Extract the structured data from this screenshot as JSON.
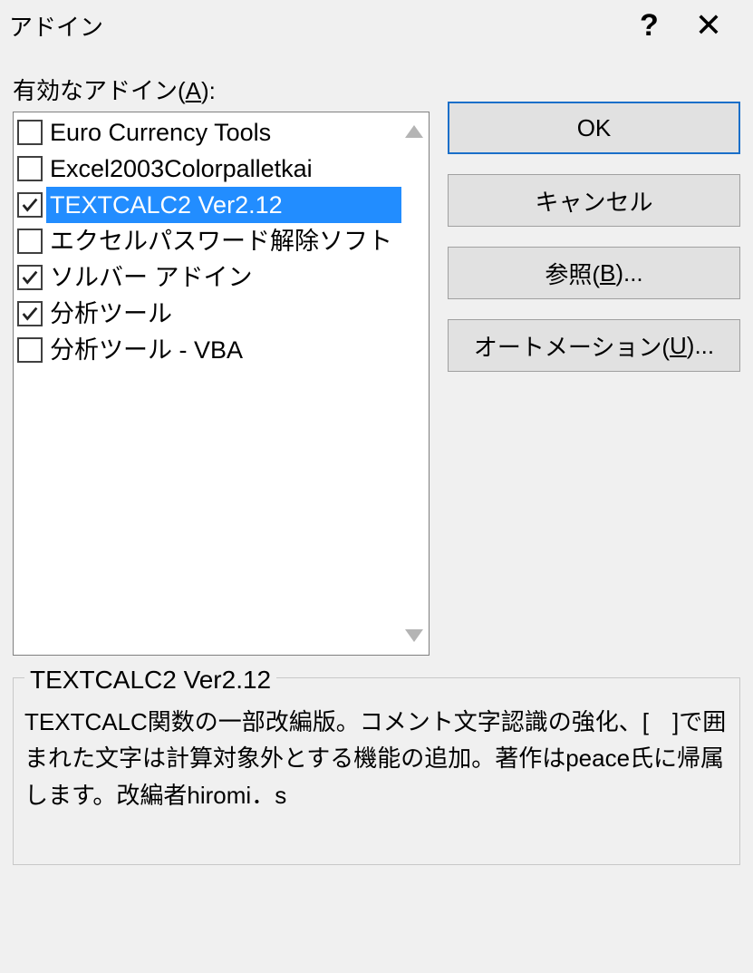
{
  "title": "アドイン",
  "label_available_prefix": "有効なアドイン(",
  "label_available_accel": "A",
  "label_available_suffix": "):",
  "items": [
    {
      "label": "Euro Currency Tools",
      "checked": false,
      "selected": false
    },
    {
      "label": "Excel2003Colorpalletkai",
      "checked": false,
      "selected": false
    },
    {
      "label": "TEXTCALC2  Ver2.12",
      "checked": true,
      "selected": true
    },
    {
      "label": "エクセルパスワード解除ソフト",
      "checked": false,
      "selected": false
    },
    {
      "label": "ソルバー アドイン",
      "checked": true,
      "selected": false
    },
    {
      "label": "分析ツール",
      "checked": true,
      "selected": false
    },
    {
      "label": "分析ツール - VBA",
      "checked": false,
      "selected": false
    }
  ],
  "buttons": {
    "ok": "OK",
    "cancel": "キャンセル",
    "browse_prefix": "参照(",
    "browse_accel": "B",
    "browse_suffix": ")...",
    "automation_prefix": "オートメーション(",
    "automation_accel": "U",
    "automation_suffix": ")..."
  },
  "description": {
    "legend": "TEXTCALC2  Ver2.12",
    "body": "TEXTCALC関数の一部改編版。コメント文字認識の強化、[　]で囲まれた文字は計算対象外とする機能の追加。著作はpeace氏に帰属します。改編者hiromi．s"
  }
}
